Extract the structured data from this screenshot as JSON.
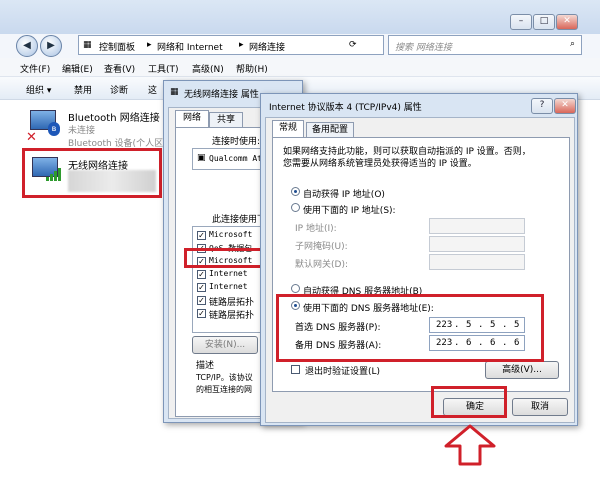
{
  "explorer": {
    "address": [
      "控制面板",
      "网络和 Internet",
      "网络连接"
    ],
    "search_placeholder": "搜索 网络连接",
    "menu": [
      "文件(F)",
      "编辑(E)",
      "查看(V)",
      "工具(T)",
      "高级(N)",
      "帮助(H)"
    ],
    "toolbar": [
      "组织 ▾",
      "禁用",
      "诊断",
      "这"
    ],
    "connections": [
      {
        "name": "Bluetooth 网络连接",
        "status": "未连接",
        "device": "Bluetooth 设备(个人区"
      },
      {
        "name": "无线网络连接",
        "status": "",
        "device": ""
      }
    ]
  },
  "props": {
    "title": "无线网络连接 属性",
    "tabs": [
      "网络",
      "共享"
    ],
    "connect_using": "连接时使用:",
    "adapter": "Qualcomm At",
    "items_label": "此连接使用下列项",
    "items": [
      "Microsoft",
      "QoS 数据包",
      "Microsoft",
      "Internet",
      "Internet",
      "链路层拓扑",
      "链路层拓扑"
    ],
    "install": "安装(N)...",
    "desc_label": "描述",
    "desc_lines": [
      "TCP/IP。该协议",
      "的相互连接的网"
    ]
  },
  "ipv4": {
    "title": "Internet 协议版本 4 (TCP/IPv4) 属性",
    "tabs": [
      "常规",
      "备用配置"
    ],
    "info1": "如果网络支持此功能，则可以获取自动指派的 IP 设置。否则，",
    "info2": "您需要从网络系统管理员处获得适当的 IP 设置。",
    "auto_ip": "自动获得 IP 地址(O)",
    "manual_ip": "使用下面的 IP 地址(S):",
    "ip_label": "IP 地址(I):",
    "mask_label": "子网掩码(U):",
    "gateway_label": "默认网关(D):",
    "auto_dns": "自动获得 DNS 服务器地址(B)",
    "manual_dns": "使用下面的 DNS 服务器地址(E):",
    "dns1_label": "首选 DNS 服务器(P):",
    "dns1": [
      "223",
      "5",
      "5",
      "5"
    ],
    "dns2_label": "备用 DNS 服务器(A):",
    "dns2": [
      "223",
      "6",
      "6",
      "6"
    ],
    "validate": "退出时验证设置(L)",
    "advanced": "高级(V)...",
    "ok": "确定",
    "cancel": "取消",
    "help": "?",
    "close": "✕"
  },
  "colors": {
    "highlight": "#d0202a",
    "arrow": "#d0202a"
  }
}
